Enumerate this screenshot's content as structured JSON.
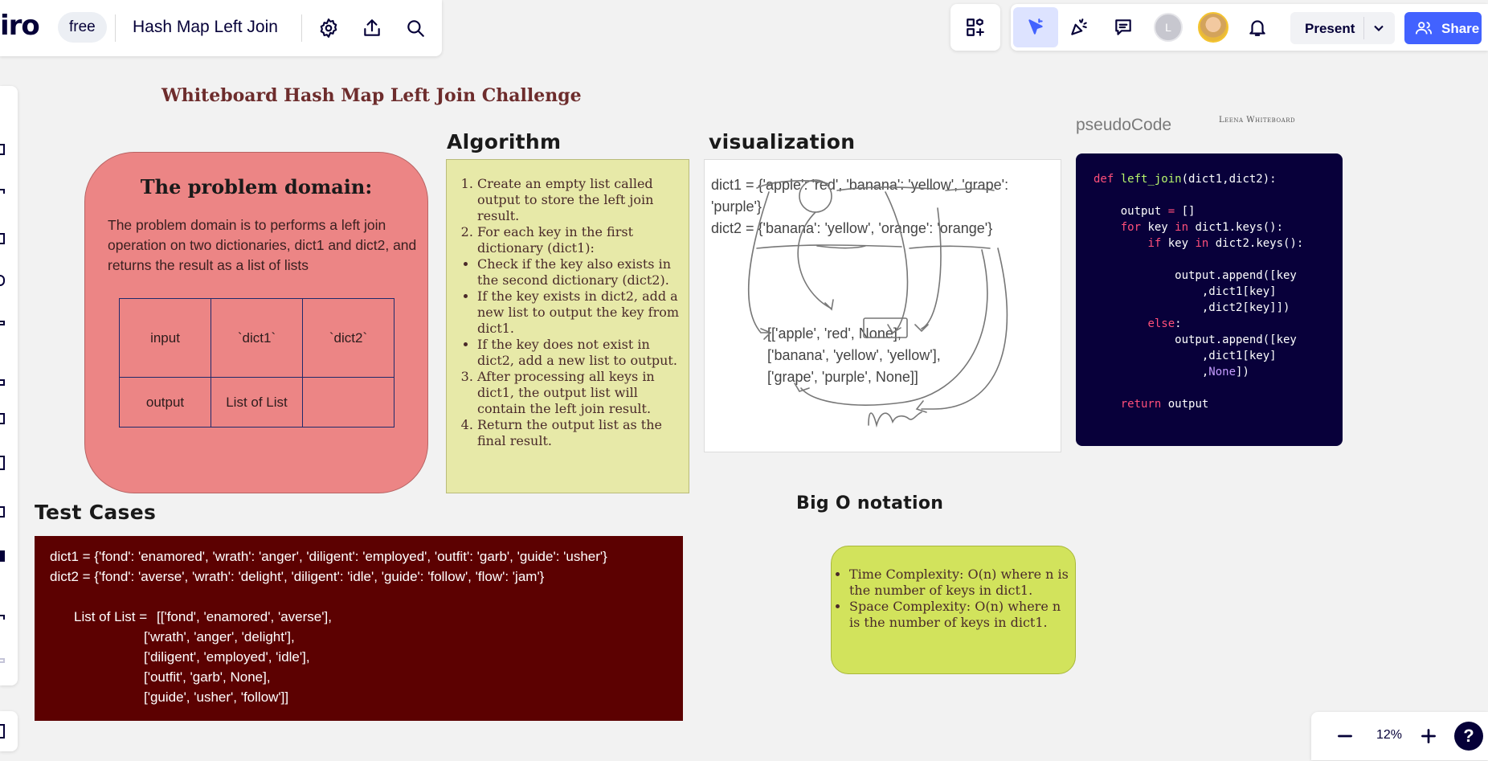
{
  "app": {
    "logo": "iro",
    "plan_badge": "free",
    "board_title": "Hash Map Left Join"
  },
  "topbar": {
    "present_label": "Present",
    "share_label": "Share",
    "avatar_initial": "L"
  },
  "zoom": {
    "value": "12%",
    "help": "?"
  },
  "board": {
    "heading": "Whiteboard Hash Map Left Join Challenge",
    "problem": {
      "title": "The problem domain:",
      "text": "The problem domain is to performs a left join operation on two dictionaries, dict1 and dict2, and returns the result as a list of lists",
      "table": [
        [
          "input",
          "`dict1`",
          "`dict2`"
        ],
        [
          "output",
          "List of List",
          ""
        ]
      ]
    },
    "algorithm": {
      "title": "Algorithm",
      "steps": [
        "Create an empty list called output to store the left join result.",
        "For each key in the first dictionary (dict1):",
        "Check if the key also exists in the second dictionary (dict2).",
        "If the key exists in dict2, add a new list to output the key from dict1.",
        "If the key does not exist in dict2, add a new list to output.",
        "After processing all keys in dict1, the output list will contain the left join result.",
        "Return the output list as the final result."
      ]
    },
    "visualization": {
      "title": "visualization",
      "dict1": "dict1 = {'apple': 'red', 'banana': 'yellow', 'grape': 'purple'}",
      "dict2": "dict2 = {'banana': 'yellow', 'orange': 'orange'}",
      "result_lines": [
        "[['apple', 'red', None],",
        "['banana', 'yellow', 'yellow'],",
        "['grape', 'purple', None]]"
      ],
      "handwritten_note": "None"
    },
    "pseudocode": {
      "label": "pseudoCode",
      "author_label": "Leena Whiteboard",
      "lines": [
        "def left_join(dict1,dict2):",
        "",
        "    output = []",
        "    for key in dict1.keys():",
        "        if key in dict2.keys():",
        "",
        "            output.append([key",
        "                ,dict1[key]",
        "                ,dict2[key]])",
        "        else:",
        "            output.append([key",
        "                ,dict1[key]",
        "                ,None])",
        "",
        "    return output"
      ]
    },
    "test_cases": {
      "title": "Test Cases",
      "dict1": "dict1 = {'fond': 'enamored', 'wrath': 'anger', 'diligent': 'employed', 'outfit': 'garb', 'guide': 'usher'}",
      "dict2": "dict2 = {'fond': 'averse', 'wrath': 'delight', 'diligent': 'idle', 'guide': 'follow', 'flow': 'jam'}",
      "result_label": "List of List = ",
      "result_lines": [
        "[['fond', 'enamored', 'averse'],",
        "['wrath', 'anger', 'delight'],",
        "['diligent', 'employed', 'idle'],",
        "['outfit', 'garb', None],",
        "['guide', 'usher', 'follow']]"
      ]
    },
    "big_o": {
      "title": "Big O notation",
      "items": [
        "Time Complexity: O(n) where n is the number of keys in dict1.",
        "Space Complexity: O(n) where n is the number of keys in dict1."
      ]
    }
  }
}
